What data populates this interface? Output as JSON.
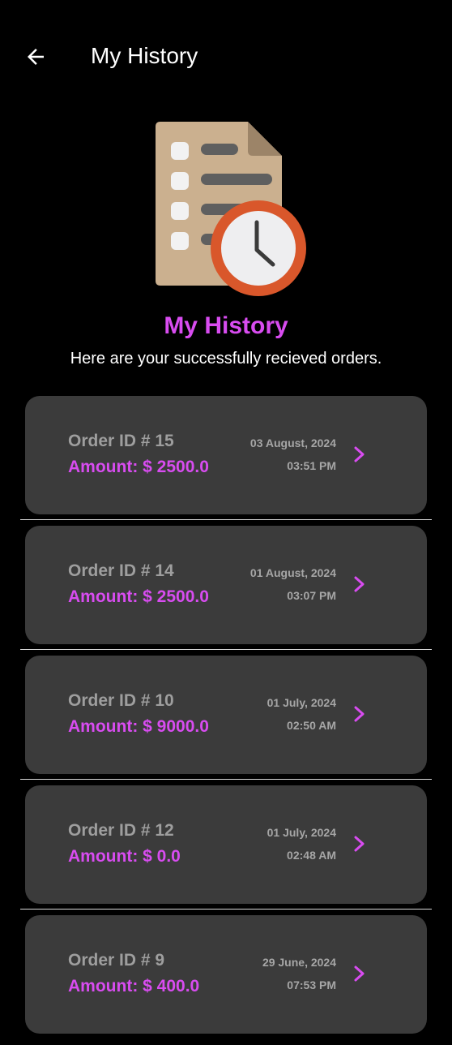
{
  "appbar": {
    "title": "My History",
    "back_icon": "arrow-left-icon"
  },
  "hero": {
    "icon": "history-document-clock-icon",
    "title": "My History",
    "subtitle": "Here are your successfully recieved orders."
  },
  "colors": {
    "background": "#000000",
    "card": "#3b3b3b",
    "accent": "#d84cf0",
    "muted_text": "#9e9e9e",
    "divider": "#d9d9d9"
  },
  "orders": [
    {
      "id_label": "Order ID # 15",
      "amount_label": "Amount: $ 2500.0",
      "date": "03 August, 2024",
      "time": "03:51 PM"
    },
    {
      "id_label": "Order ID # 14",
      "amount_label": "Amount: $ 2500.0",
      "date": "01 August, 2024",
      "time": "03:07 PM"
    },
    {
      "id_label": "Order ID # 10",
      "amount_label": "Amount: $ 9000.0",
      "date": "01 July, 2024",
      "time": "02:50 AM"
    },
    {
      "id_label": "Order ID # 12",
      "amount_label": "Amount: $ 0.0",
      "date": "01 July, 2024",
      "time": "02:48 AM"
    },
    {
      "id_label": "Order ID # 9",
      "amount_label": "Amount: $ 400.0",
      "date": "29 June, 2024",
      "time": "07:53 PM"
    }
  ]
}
